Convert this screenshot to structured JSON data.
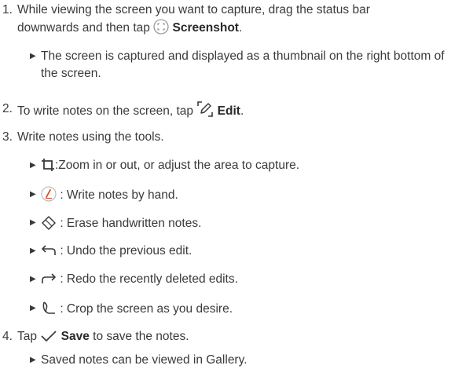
{
  "steps": [
    {
      "number": "1.",
      "text_before": "While viewing the screen you want to capture, drag the status bar downwards and then tap",
      "icon": "screenshot-icon",
      "bold": "Screenshot",
      "text_after": ".",
      "bullets": [
        {
          "text": "The screen is captured and displayed as a thumbnail on the right bottom of the screen."
        }
      ]
    },
    {
      "number": "2.",
      "text_before": "To write notes on the screen, tap",
      "icon": "edit-icon",
      "bold": "Edit",
      "text_after": ".",
      "bullets": []
    },
    {
      "number": "3.",
      "text": "Write notes using the tools.",
      "bullets": [
        {
          "icon": "crop-frame-icon",
          "text": ":Zoom in or out, or adjust the area to capture."
        },
        {
          "icon": "pen-icon",
          "text": ": Write notes by hand."
        },
        {
          "icon": "eraser-icon",
          "text": ": Erase handwritten notes."
        },
        {
          "icon": "undo-icon",
          "text": ": Undo the previous edit."
        },
        {
          "icon": "redo-icon",
          "text": ": Redo the recently deleted edits."
        },
        {
          "icon": "crop-icon",
          "text": ": Crop the screen as you desire."
        }
      ]
    },
    {
      "number": "4.",
      "text_before": "Tap",
      "icon": "checkmark-icon",
      "bold": "Save",
      "text_after": "to save the notes.",
      "bullets": [
        {
          "text": "Saved notes can be viewed in Gallery."
        }
      ]
    }
  ],
  "bullet_marker": "▶",
  "colors": {
    "text": "#3a3a3a",
    "pen_accent": "#d94a2b"
  }
}
